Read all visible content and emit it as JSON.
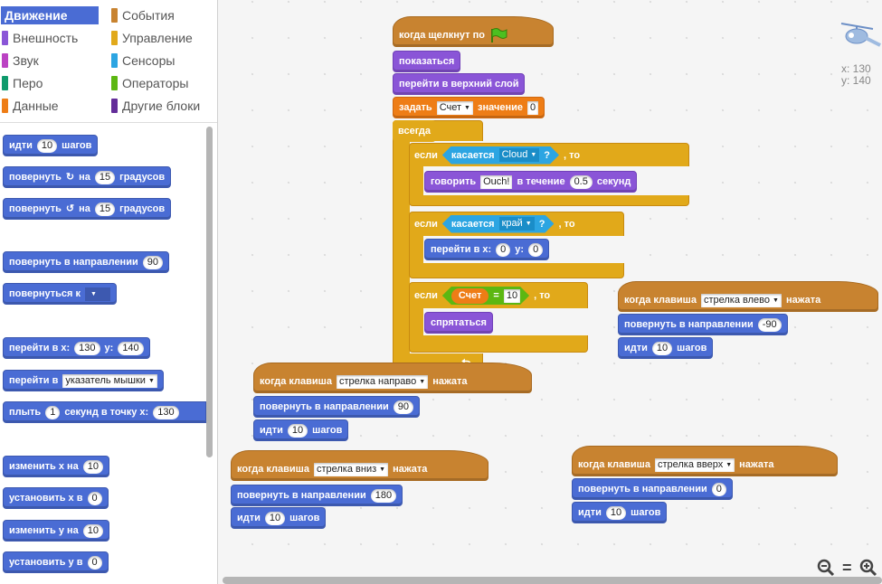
{
  "categories": [
    {
      "label": "Движение",
      "color": "#4a6cd4",
      "active": true
    },
    {
      "label": "Внешность",
      "color": "#8a55d7"
    },
    {
      "label": "Звук",
      "color": "#bb42c3"
    },
    {
      "label": "Перо",
      "color": "#0e9a6c"
    },
    {
      "label": "Данные",
      "color": "#ee7d16"
    },
    {
      "label": "События",
      "color": "#c88330"
    },
    {
      "label": "Управление",
      "color": "#e1a91a"
    },
    {
      "label": "Сенсоры",
      "color": "#2ca5e2"
    },
    {
      "label": "Операторы",
      "color": "#5cb712"
    },
    {
      "label": "Другие блоки",
      "color": "#632d99"
    }
  ],
  "palette": {
    "move": {
      "a": "идти",
      "n": "10",
      "b": "шагов"
    },
    "turn_right": {
      "a": "повернуть",
      "b": "на",
      "n": "15",
      "c": "градусов"
    },
    "turn_left": {
      "a": "повернуть",
      "b": "на",
      "n": "15",
      "c": "градусов"
    },
    "point_dir": {
      "a": "повернуть в направлении",
      "n": "90"
    },
    "point_towards": {
      "a": "повернуться к"
    },
    "goto_xy": {
      "a": "перейти в x:",
      "x": "130",
      "b": "y:",
      "y": "140"
    },
    "goto": {
      "a": "перейти в",
      "d": "указатель мышки"
    },
    "glide": {
      "a": "плыть",
      "n": "1",
      "b": "секунд в точку x:",
      "x": "130"
    },
    "change_x": {
      "a": "изменить х на",
      "n": "10"
    },
    "set_x": {
      "a": "установить х в",
      "n": "0"
    },
    "change_y": {
      "a": "изменить у на",
      "n": "10"
    },
    "set_y": {
      "a": "установить у в",
      "n": "0"
    }
  },
  "script_main": {
    "hat": "когда щелкнут по",
    "show": "показаться",
    "front": "перейти в верхний слой",
    "set_a": "задать",
    "set_var": "Счет",
    "set_b": "значение",
    "set_val": "0",
    "forever": "всегда",
    "if1": {
      "a": "если",
      "sens": "касается",
      "obj": "Cloud",
      "q": "?",
      "b": ", то"
    },
    "say": {
      "a": "говорить",
      "msg": "Ouch!",
      "b": "в течение",
      "n": "0.5",
      "c": "секунд"
    },
    "if2": {
      "a": "если",
      "sens": "касается",
      "obj": "край",
      "q": "?",
      "b": ", то"
    },
    "goto": {
      "a": "перейти в x:",
      "x": "0",
      "b": "y:",
      "y": "0"
    },
    "if3": {
      "a": "если",
      "var": "Счет",
      "eq": "=",
      "val": "10",
      "b": ", то"
    },
    "hide": "спрятаться"
  },
  "script_left": {
    "a": "когда клавиша",
    "key": "стрелка влево",
    "b": "нажата",
    "dir_a": "повернуть в направлении",
    "dir": "-90",
    "move_a": "идти",
    "move_n": "10",
    "move_b": "шагов"
  },
  "script_right": {
    "a": "когда клавиша",
    "key": "стрелка направо",
    "b": "нажата",
    "dir_a": "повернуть в направлении",
    "dir": "90",
    "move_a": "идти",
    "move_n": "10",
    "move_b": "шагов"
  },
  "script_down": {
    "a": "когда клавиша",
    "key": "стрелка вниз",
    "b": "нажата",
    "dir_a": "повернуть в направлении",
    "dir": "180",
    "move_a": "идти",
    "move_n": "10",
    "move_b": "шагов"
  },
  "script_up": {
    "a": "когда клавиша",
    "key": "стрелка вверх",
    "b": "нажата",
    "dir_a": "повернуть в направлении",
    "dir": "0",
    "move_a": "идти",
    "move_n": "10",
    "move_b": "шагов"
  },
  "sprite_coords": {
    "x": "x: 130",
    "y": "y: 140"
  },
  "zoom": {
    "out": "−",
    "reset": "=",
    "in": "+"
  }
}
